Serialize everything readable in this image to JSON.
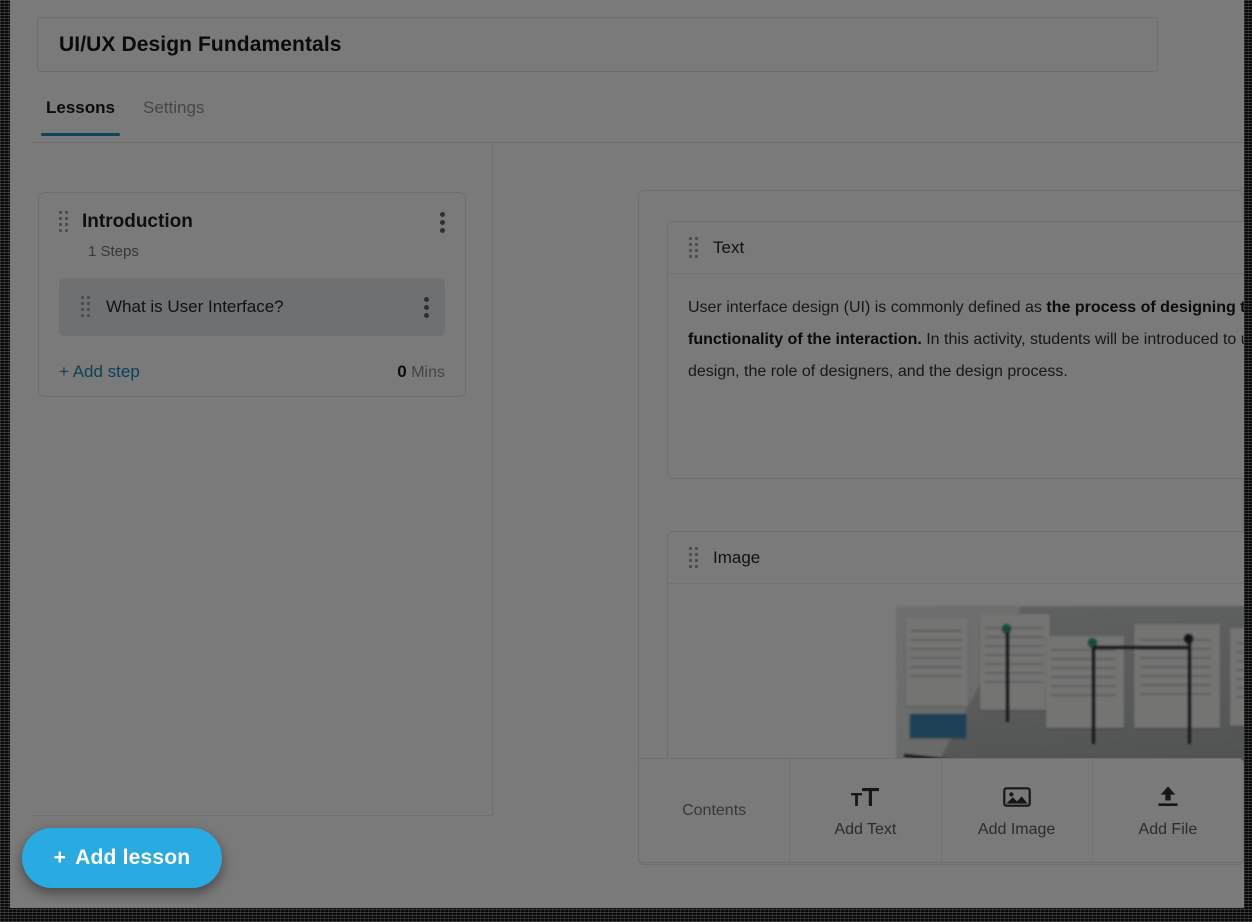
{
  "header": {
    "course_title": "UI/UX Design Fundamentals",
    "tabs": [
      {
        "label": "Lessons",
        "active": true
      },
      {
        "label": "Settings",
        "active": false
      }
    ]
  },
  "sidebar": {
    "lesson": {
      "name": "Introduction",
      "steps_count": "1 Steps",
      "drag_handle_icon": "drag-handle-icon",
      "menu_icon": "kebab-menu-icon",
      "steps": [
        {
          "name": "What is User Interface?",
          "selected": true
        }
      ],
      "add_step_label": "+ Add step",
      "duration_value": "0",
      "duration_unit": "Mins"
    },
    "add_lesson_label": "Add lesson",
    "add_lesson_plus": "+",
    "add_lesson_color": "#29abe2"
  },
  "editor": {
    "blocks": [
      {
        "type": "text",
        "title": "Text",
        "lines": [
          {
            "runs": [
              {
                "text": "User interface design (UI) is commonly defined as ",
                "bold": false
              },
              {
                "text": "the process of designing the look and",
                "bold": true
              }
            ]
          },
          {
            "runs": [
              {
                "text": "functionality of the interaction.",
                "bold": true
              },
              {
                "text": " In this activity, students will be introduced to user interface",
                "bold": false
              }
            ]
          },
          {
            "runs": [
              {
                "text": "design, the role of designers, and the design process.",
                "bold": false
              }
            ]
          }
        ]
      },
      {
        "type": "image",
        "title": "Image",
        "alt": "Blurred photo of a storyboard wall with paper cards connected by black string and colored pins"
      }
    ]
  },
  "toolbar": {
    "items": [
      {
        "label": "Contents",
        "icon": "none",
        "interactable": false
      },
      {
        "label": "Add Text",
        "icon": "text-size-icon",
        "interactable": true
      },
      {
        "label": "Add Image",
        "icon": "image-icon",
        "interactable": true
      },
      {
        "label": "Add File",
        "icon": "upload-icon",
        "interactable": true
      }
    ]
  },
  "theme": {
    "accent": "#29abe2",
    "tab_underline": "#1f8fc0",
    "link": "#1f89b8",
    "selected_step_bg": "#e6eaec",
    "scrim": "rgba(0,0,0,0.52)"
  }
}
